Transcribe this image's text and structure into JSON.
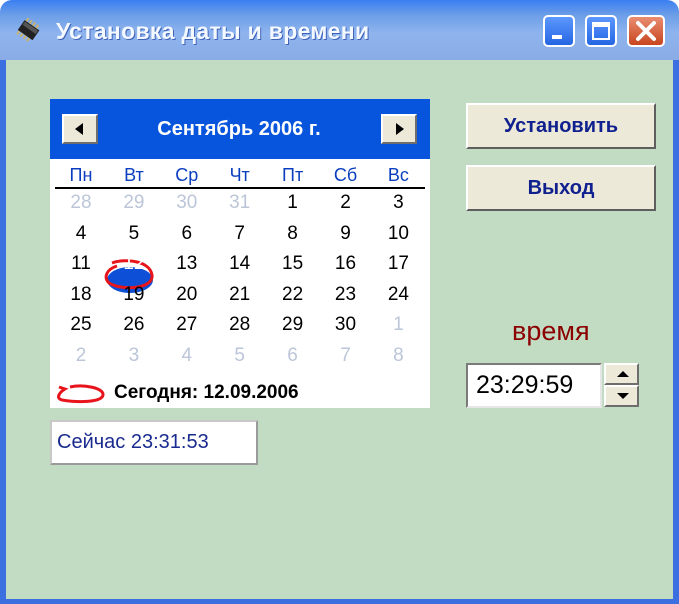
{
  "window": {
    "title": "Установка даты и времени",
    "controls": [
      "minimize-icon",
      "maximize-icon",
      "close-icon"
    ],
    "accent": "#3c6fe0",
    "client_bg": "#c2dcc4"
  },
  "calendar": {
    "month_label": "Сентябрь 2006 г.",
    "prev_icon": "triangle-left-icon",
    "next_icon": "triangle-right-icon",
    "weekdays": [
      "Пн",
      "Вт",
      "Ср",
      "Чт",
      "Пт",
      "Сб",
      "Вс"
    ],
    "weeks": [
      [
        {
          "d": "28",
          "m": true
        },
        {
          "d": "29",
          "m": true
        },
        {
          "d": "30",
          "m": true
        },
        {
          "d": "31",
          "m": true
        },
        {
          "d": "1"
        },
        {
          "d": "2"
        },
        {
          "d": "3"
        }
      ],
      [
        {
          "d": "4"
        },
        {
          "d": "5"
        },
        {
          "d": "6"
        },
        {
          "d": "7"
        },
        {
          "d": "8"
        },
        {
          "d": "9"
        },
        {
          "d": "10"
        }
      ],
      [
        {
          "d": "11"
        },
        {
          "d": "12",
          "sel": true
        },
        {
          "d": "13"
        },
        {
          "d": "14"
        },
        {
          "d": "15"
        },
        {
          "d": "16"
        },
        {
          "d": "17"
        }
      ],
      [
        {
          "d": "18"
        },
        {
          "d": "19"
        },
        {
          "d": "20"
        },
        {
          "d": "21"
        },
        {
          "d": "22"
        },
        {
          "d": "23"
        },
        {
          "d": "24"
        }
      ],
      [
        {
          "d": "25"
        },
        {
          "d": "26"
        },
        {
          "d": "27"
        },
        {
          "d": "28"
        },
        {
          "d": "29"
        },
        {
          "d": "30"
        },
        {
          "d": "1",
          "m": true
        }
      ],
      [
        {
          "d": "2",
          "m": true
        },
        {
          "d": "3",
          "m": true
        },
        {
          "d": "4",
          "m": true
        },
        {
          "d": "5",
          "m": true
        },
        {
          "d": "6",
          "m": true
        },
        {
          "d": "7",
          "m": true
        },
        {
          "d": "8",
          "m": true
        }
      ]
    ],
    "today_label": "Сегодня: 12.09.2006",
    "header_color": "#0855dd",
    "weekday_color": "#0a3ebf",
    "muted_color": "#bcc6d8",
    "today_ring_color": "#e8141c"
  },
  "buttons": {
    "set": "Установить",
    "exit": "Выход"
  },
  "time": {
    "label": "время",
    "value": "23:29:59"
  },
  "now": {
    "text": "Сейчас 23:31:53"
  }
}
